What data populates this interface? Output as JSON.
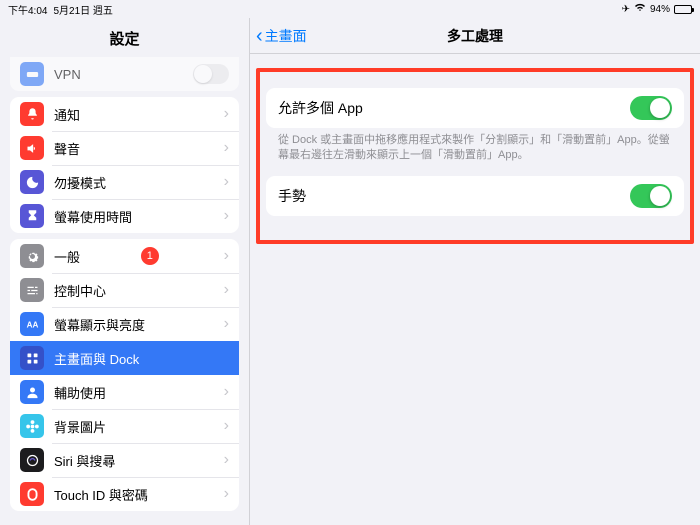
{
  "status": {
    "time": "下午4:04",
    "date": "5月21日 週五",
    "battery": "94%"
  },
  "sidebar": {
    "title": "設定",
    "vpn_row": "VPN",
    "group1": [
      {
        "label": "通知",
        "icon": "bell",
        "bg": "#ff3b30"
      },
      {
        "label": "聲音",
        "icon": "speaker",
        "bg": "#ff3b30"
      },
      {
        "label": "勿擾模式",
        "icon": "moon",
        "bg": "#5856d6"
      },
      {
        "label": "螢幕使用時間",
        "icon": "hourglass",
        "bg": "#5856d6"
      }
    ],
    "group2": [
      {
        "label": "一般",
        "icon": "gear",
        "bg": "#8e8e93",
        "badge": "1"
      },
      {
        "label": "控制中心",
        "icon": "sliders",
        "bg": "#8e8e93"
      },
      {
        "label": "螢幕顯示與亮度",
        "icon": "aa",
        "bg": "#3478f6"
      },
      {
        "label": "主畫面與 Dock",
        "icon": "grid",
        "bg": "#3451c9",
        "selected": true
      },
      {
        "label": "輔助使用",
        "icon": "person",
        "bg": "#3478f6"
      },
      {
        "label": "背景圖片",
        "icon": "flower",
        "bg": "#36c5ea"
      },
      {
        "label": "Siri 與搜尋",
        "icon": "siri",
        "bg": "#1c1c1e"
      },
      {
        "label": "Touch ID 與密碼",
        "icon": "finger",
        "bg": "#ff3b30"
      }
    ]
  },
  "detail": {
    "back": "主畫面",
    "title": "多工處理",
    "row1": "允許多個 App",
    "foot1": "從 Dock 或主畫面中拖移應用程式來製作「分割顯示」和「滑動置前」App。從螢幕最右邊往左滑動來顯示上一個「滑動置前」App。",
    "row2": "手勢"
  }
}
